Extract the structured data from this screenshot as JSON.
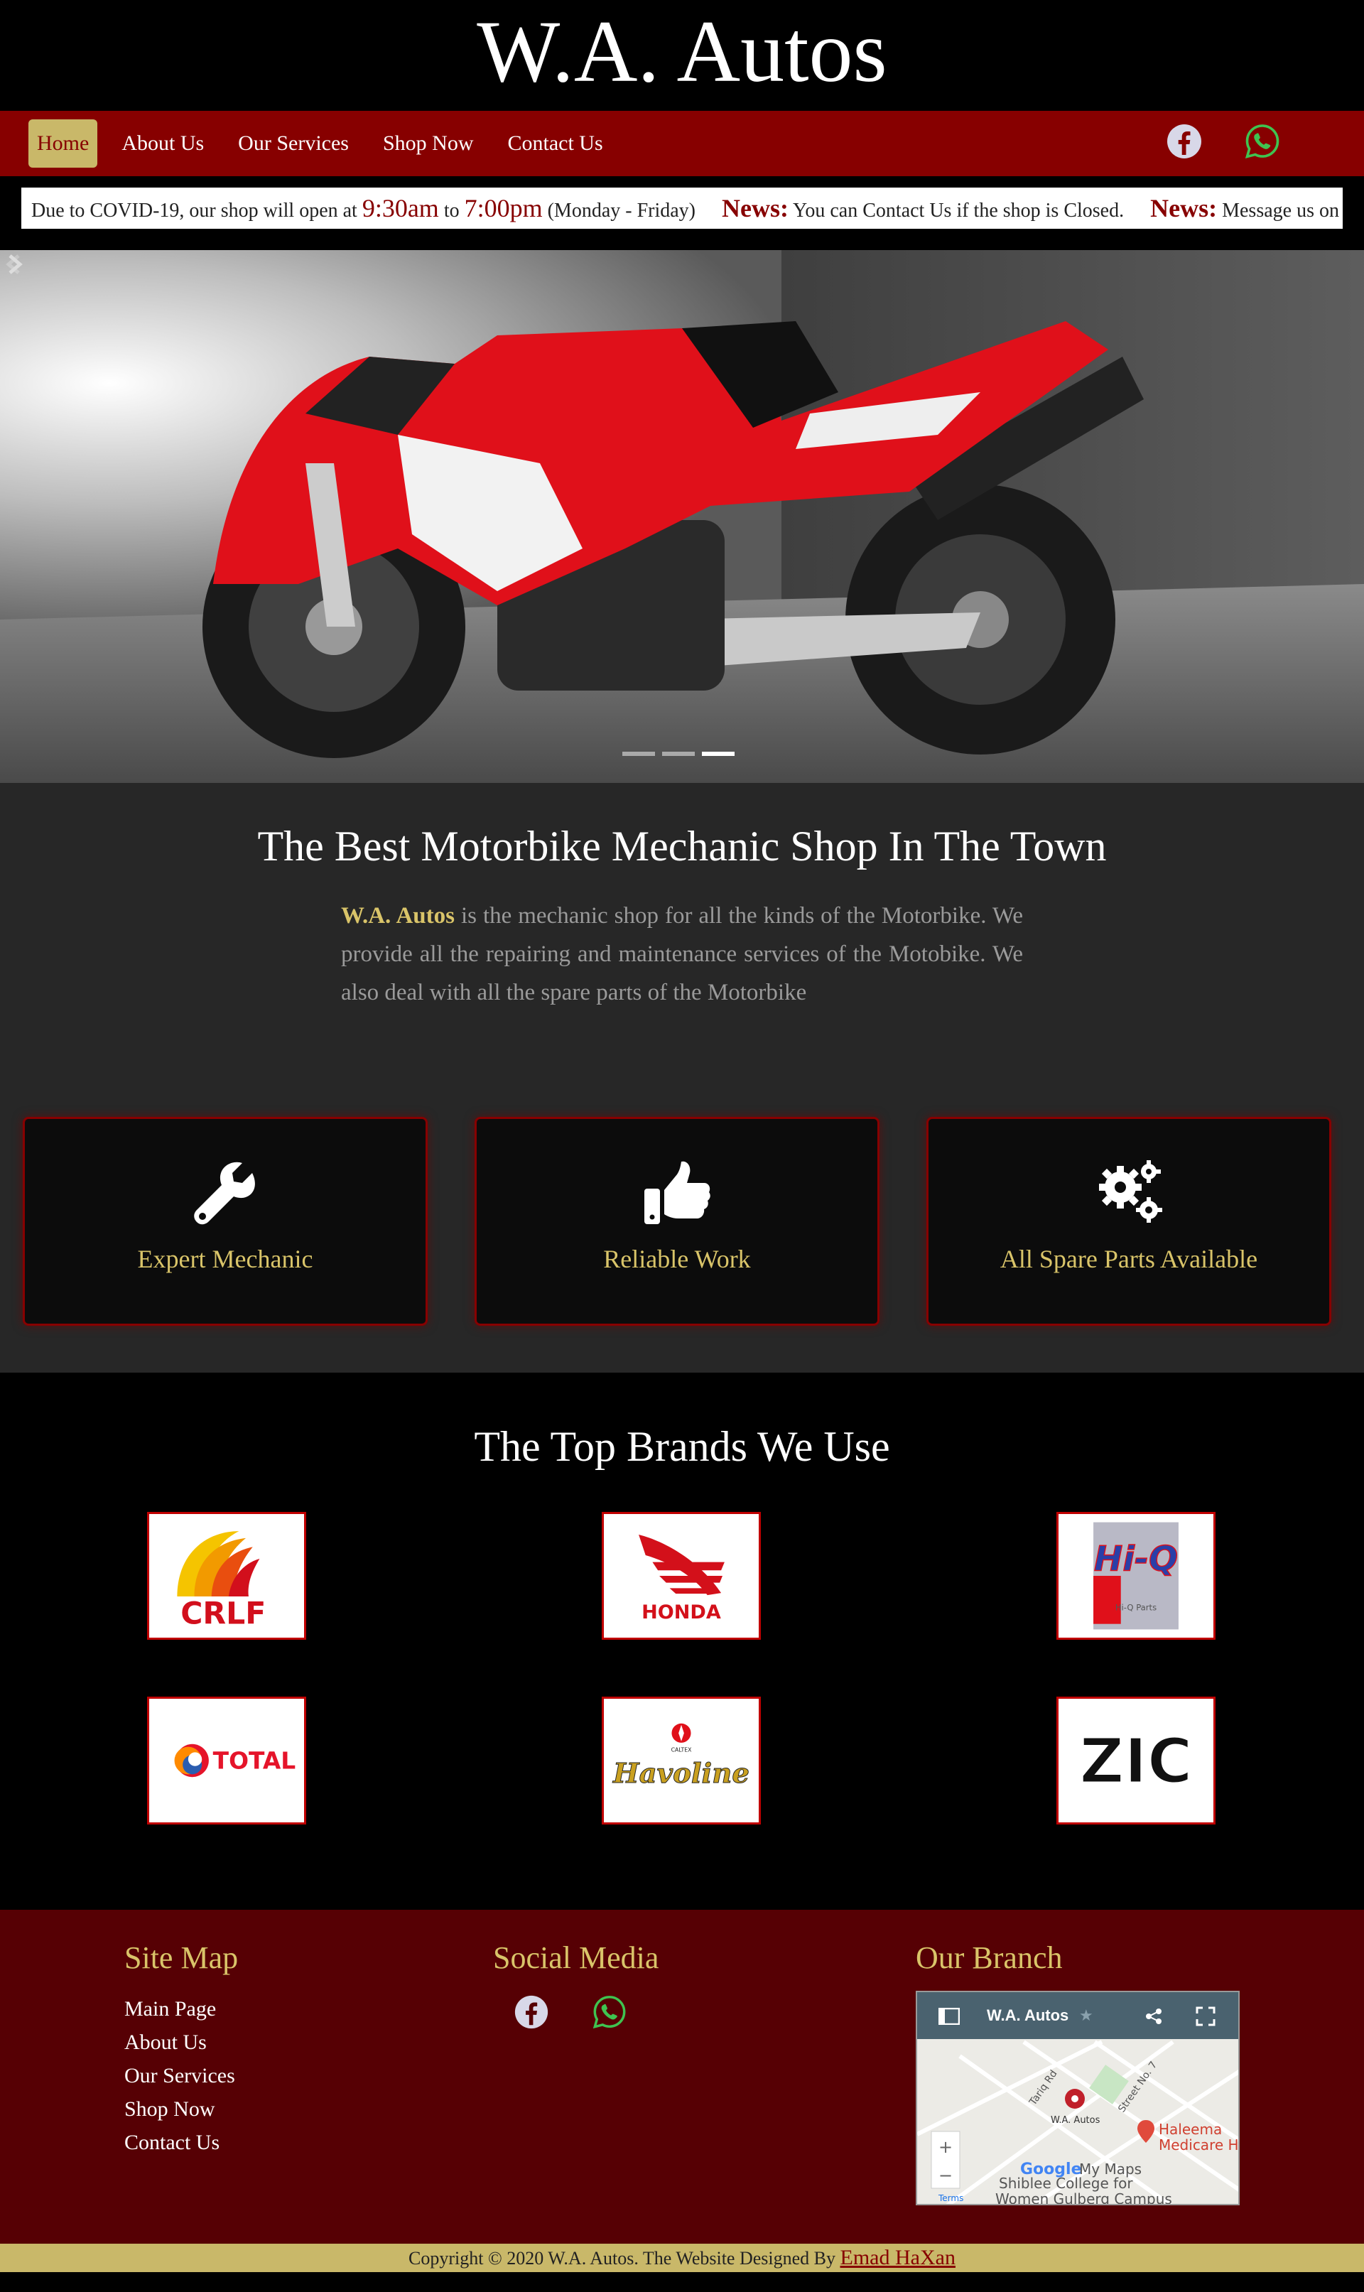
{
  "site": {
    "title": "W.A. Autos"
  },
  "nav": {
    "links": [
      {
        "label": "Home",
        "active": true
      },
      {
        "label": "About Us"
      },
      {
        "label": "Our Services"
      },
      {
        "label": "Shop Now"
      },
      {
        "label": "Contact Us"
      }
    ],
    "social": [
      "facebook-icon",
      "whatsapp-icon"
    ]
  },
  "ticker": {
    "part1": "Due to COVID-19, our shop will open at ",
    "time_open": "9:30am",
    "part2": " to ",
    "time_close": "7:00pm",
    "part3": " (Monday - Friday)",
    "news_label_1": "News:",
    "news_text_1": " You can Contact Us if the shop is Closed.",
    "news_label_2": "News:",
    "news_text_2": " Message us on W"
  },
  "hero": {
    "slides": 3,
    "active_slide": 3
  },
  "about": {
    "title": "The Best Motorbike Mechanic Shop In The Town",
    "brand": "W.A. Autos",
    "text": " is the mechanic shop for all the kinds of the Motorbike. We provide all the repairing and maintenance services of the Motobike. We also deal with all the spare parts of the Motorbike"
  },
  "features": [
    {
      "icon": "wrench-icon",
      "label": "Expert Mechanic"
    },
    {
      "icon": "thumbs-up-icon",
      "label": "Reliable Work"
    },
    {
      "icon": "gears-icon",
      "label": "All Spare Parts Available"
    }
  ],
  "brands": {
    "title": "The Top Brands We Use",
    "items": [
      "CRLF",
      "HONDA",
      "Hi-Q",
      "TOTAL",
      "Havoline",
      "ZIC"
    ],
    "caltex": "CALTEX",
    "hiq_sub": "Hi-Q Parts"
  },
  "footer": {
    "site_map_title": "Site Map",
    "site_map_links": [
      "Main Page",
      "About Us",
      "Our Services",
      "Shop Now",
      "Contact Us"
    ],
    "social_title": "Social Media",
    "branch_title": "Our Branch",
    "map": {
      "place": "W.A. Autos",
      "pin_label": "W.A. Autos",
      "labels": [
        "Tariq Rd",
        "Street No. 7",
        "Haleema",
        "Medicare Ho",
        "Shiblee College for",
        "Women Gulberg Campus",
        "Google",
        "My Maps",
        "Terms"
      ]
    }
  },
  "copyright": {
    "text": "Copyright © 2020 W.A. Autos. The Website Designed By ",
    "author": "Emad HaXan"
  },
  "colors": {
    "nav": "#870000",
    "accent": "#c9b869",
    "footer": "#560004",
    "gold_text": "#d9c469"
  }
}
